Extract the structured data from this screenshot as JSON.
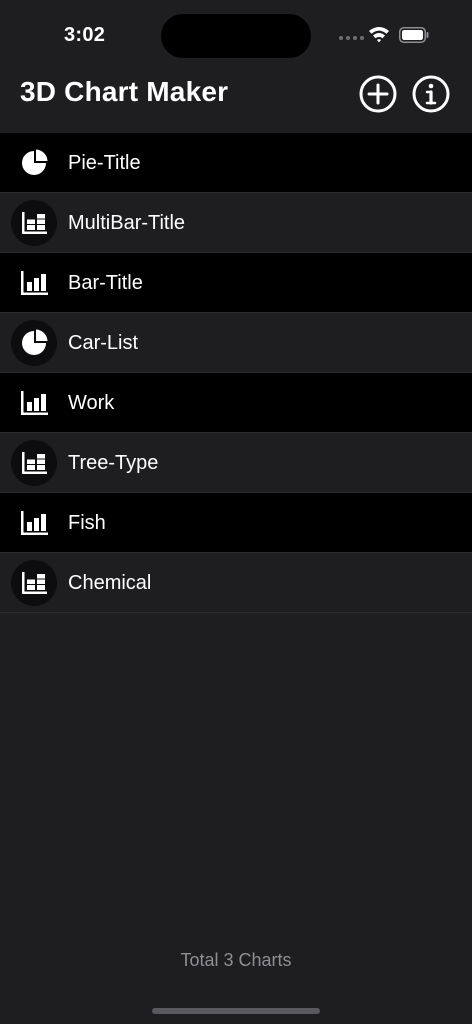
{
  "status": {
    "time": "3:02"
  },
  "header": {
    "title": "3D Chart Maker",
    "add_icon": "plus-circle-icon",
    "info_icon": "info-circle-icon"
  },
  "charts": [
    {
      "label": "Pie-Title",
      "icon": "pie-chart-icon"
    },
    {
      "label": "MultiBar-Title",
      "icon": "multibar-chart-icon"
    },
    {
      "label": "Bar-Title",
      "icon": "bar-chart-icon"
    },
    {
      "label": "Car-List",
      "icon": "pie-chart-icon"
    },
    {
      "label": "Work",
      "icon": "bar-chart-icon"
    },
    {
      "label": "Tree-Type",
      "icon": "multibar-chart-icon"
    },
    {
      "label": "Fish",
      "icon": "bar-chart-icon"
    },
    {
      "label": "Chemical",
      "icon": "multibar-chart-icon"
    }
  ],
  "footer": {
    "total_text": "Total 3 Charts"
  },
  "colors": {
    "background": "#1e1e20",
    "row_dark": "#000000",
    "text": "#ffffff",
    "muted": "#8e8e93"
  }
}
